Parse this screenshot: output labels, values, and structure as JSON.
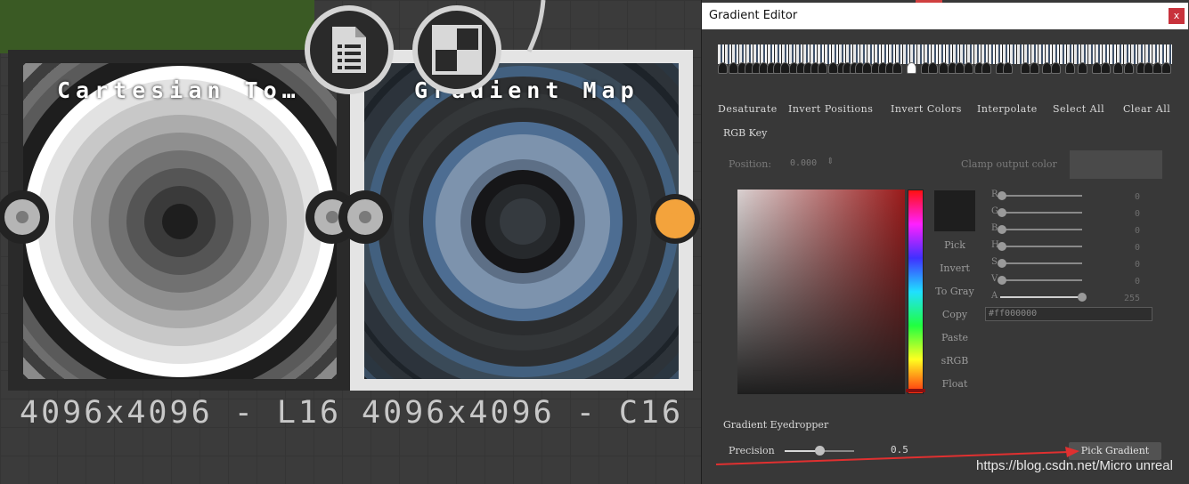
{
  "nodes": [
    {
      "title": "Cartesian To…",
      "footer": "4096x4096 - L16",
      "icon": "document-list-icon"
    },
    {
      "title": "Gradient Map",
      "footer": "4096x4096 - C16",
      "icon": "gradient-map-icon"
    }
  ],
  "editor": {
    "window_title": "Gradient Editor",
    "close_label": "x",
    "toolbar": [
      "Desaturate",
      "Invert Positions",
      "Invert Colors",
      "Interpolate",
      "Select All",
      "Clear All"
    ],
    "section_label": "RGB Key",
    "position_label": "Position:",
    "position_value": "0.000",
    "clamp_label": "Clamp output color",
    "side_buttons": [
      "Pick",
      "Invert",
      "To Gray",
      "Copy",
      "Paste",
      "sRGB",
      "Float"
    ],
    "channels": [
      {
        "label": "R",
        "value": "0",
        "level": 0
      },
      {
        "label": "G",
        "value": "0",
        "level": 0
      },
      {
        "label": "B",
        "value": "0",
        "level": 0
      },
      {
        "label": "H",
        "value": "0",
        "level": 0
      },
      {
        "label": "S",
        "value": "0",
        "level": 0
      },
      {
        "label": "V",
        "value": "0",
        "level": 0
      },
      {
        "label": "A",
        "value": "255",
        "level": 1.0
      }
    ],
    "hex_value": "#ff000000",
    "eyedropper_label": "Gradient Eyedropper",
    "precision_label": "Precision",
    "precision_value": "0.5",
    "pick_gradient_label": "Pick Gradient"
  },
  "colors": {
    "socket_output_2": "#f3a33c",
    "node2_titlebar": "#3a5a24",
    "annotation_arrow": "#e03030"
  },
  "watermark": "https://blog.csdn.net/Micro unreal"
}
